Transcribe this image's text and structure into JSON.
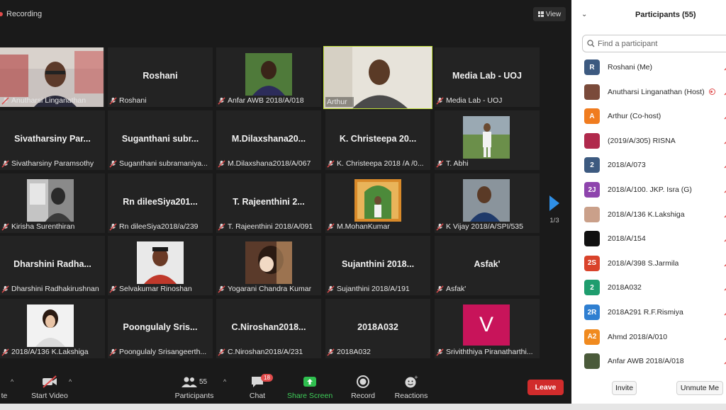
{
  "meeting": {
    "recording_label": "Recording",
    "view_label": "View",
    "pager": "1/3",
    "tiles": [
      {
        "title": "",
        "foot": "Anutharsi Linganathan",
        "kind": "photo"
      },
      {
        "title": "Roshani",
        "foot": "Roshani",
        "kind": "name"
      },
      {
        "title": "",
        "foot": "Anfar AWB 2018/A/018",
        "kind": "photo"
      },
      {
        "title": "",
        "foot": "Arthur",
        "kind": "video"
      },
      {
        "title": "Media Lab - UOJ",
        "foot": "Media Lab - UOJ",
        "kind": "name"
      },
      {
        "title": "Sivatharsiny Par...",
        "foot": "Sivatharsiny Paramsothy",
        "kind": "name"
      },
      {
        "title": "Suganthani subr...",
        "foot": "Suganthani subramaniya...",
        "kind": "name"
      },
      {
        "title": "M.Dilaxshana20...",
        "foot": "M.Dilaxshana2018/A/067",
        "kind": "name"
      },
      {
        "title": "K. Christeepa 20...",
        "foot": "K. Christeepa 2018 /A /0...",
        "kind": "name"
      },
      {
        "title": "",
        "foot": "T. Abhi",
        "kind": "photo"
      },
      {
        "title": "",
        "foot": "Kirisha Surenthiran",
        "kind": "photo"
      },
      {
        "title": "Rn dileeSiya201...",
        "foot": "Rn dileeSiya2018/a/239",
        "kind": "name"
      },
      {
        "title": "T. Rajeenthini 2...",
        "foot": "T. Rajeenthini 2018/A/091",
        "kind": "name"
      },
      {
        "title": "",
        "foot": "M.MohanKumar",
        "kind": "photo"
      },
      {
        "title": "",
        "foot": "K Vijay 2018/A/SPI/535",
        "kind": "photo"
      },
      {
        "title": "Dharshini Radha...",
        "foot": "Dharshini Radhakirushnan",
        "kind": "name"
      },
      {
        "title": "",
        "foot": "Selvakumar Rinoshan",
        "kind": "photo"
      },
      {
        "title": "",
        "foot": "Yogarani Chandra Kumar",
        "kind": "photo"
      },
      {
        "title": "Sujanthini 2018...",
        "foot": "Sujanthini 2018/A/191",
        "kind": "name"
      },
      {
        "title": "Asfak'",
        "foot": "Asfak'",
        "kind": "name"
      },
      {
        "title": "",
        "foot": "2018/A/136 K.Lakshiga",
        "kind": "photo"
      },
      {
        "title": "Poongulaly Sris...",
        "foot": "Poongulaly Srisangeerth...",
        "kind": "name"
      },
      {
        "title": "C.Niroshan2018...",
        "foot": "C.Niroshan2018/A/231",
        "kind": "name"
      },
      {
        "title": "2018A032",
        "foot": "2018A032",
        "kind": "name"
      },
      {
        "title": "V",
        "foot": "Sriviththiya Piranatharthi...",
        "kind": "avatar"
      }
    ]
  },
  "toolbar": {
    "unmute_label": "te",
    "video_label": "Start Video",
    "participants_label": "Participants",
    "participants_count": "55",
    "chat_label": "Chat",
    "chat_badge": "18",
    "share_label": "Share Screen",
    "record_label": "Record",
    "reactions_label": "Reactions",
    "leave_label": "Leave"
  },
  "panel": {
    "title": "Participants (55)",
    "search_placeholder": "Find a participant",
    "invite_label": "Invite",
    "unmute_me_label": "Unmute Me",
    "participants": [
      {
        "name": "Roshani (Me)",
        "initials": "R",
        "color": "#3d5a80"
      },
      {
        "name": "Anutharsi Linganathan (Host)",
        "initials": "",
        "color": "#7a4a3a",
        "recording": true
      },
      {
        "name": "Arthur (Co-host)",
        "initials": "A",
        "color": "#f07c1f"
      },
      {
        "name": "(2019/A/305) RISNA",
        "initials": "",
        "color": "#b0294c"
      },
      {
        "name": "2018/A/073",
        "initials": "2",
        "color": "#3d5a80"
      },
      {
        "name": "2018/A/100. JKP. Isra (G)",
        "initials": "2J",
        "color": "#8e44ad"
      },
      {
        "name": "2018/A/136 K.Lakshiga",
        "initials": "",
        "color": "#caa08a"
      },
      {
        "name": "2018/A/154",
        "initials": "",
        "color": "#111111"
      },
      {
        "name": "2018/A/398 S.Jarmila",
        "initials": "2S",
        "color": "#d9432b"
      },
      {
        "name": "2018A032",
        "initials": "2",
        "color": "#1f9d6e"
      },
      {
        "name": "2018A291 R.F.Rismiya",
        "initials": "2R",
        "color": "#2f7fd1"
      },
      {
        "name": "Ahmd 2018/A/010",
        "initials": "A2",
        "color": "#f08a1f"
      },
      {
        "name": "Anfar AWB 2018/A/018",
        "initials": "",
        "color": "#4a5a3a"
      }
    ]
  }
}
